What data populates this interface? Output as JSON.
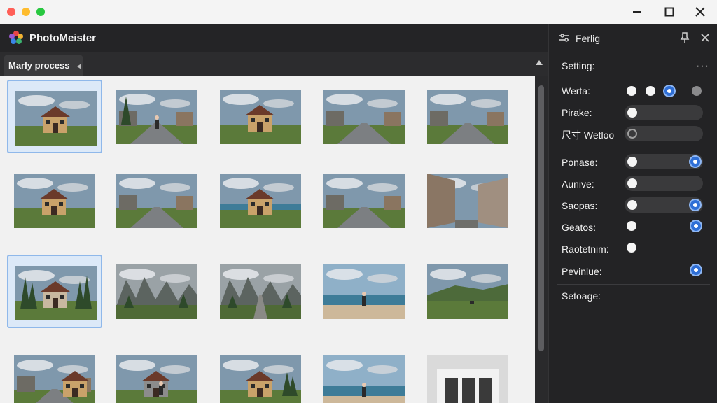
{
  "app": {
    "title": "PhotoMeister"
  },
  "tabs": [
    {
      "label": "Marly process"
    }
  ],
  "panel": {
    "title": "Ferlig",
    "settings_label": "Setting:",
    "rows": [
      {
        "label": "Werta:",
        "control": "radio-group",
        "selected_index": 2
      },
      {
        "label": "Pirake:",
        "control": "toggle",
        "value": "off"
      },
      {
        "label": "尺寸 Wetloo",
        "control": "toggle",
        "value": "off"
      },
      {
        "label": "Ponase:",
        "control": "toggle",
        "value": "on"
      },
      {
        "label": "Aunive:",
        "control": "toggle",
        "value": "off"
      },
      {
        "label": "Saopas:",
        "control": "toggle",
        "value": "on"
      },
      {
        "label": "Geatos:",
        "control": "toggle",
        "value": "on"
      },
      {
        "label": "Raotetnim:",
        "control": "toggle",
        "value": "off"
      },
      {
        "label": "Pevinlue:",
        "control": "toggle",
        "value": "on"
      },
      {
        "label": "Setoage:",
        "control": "none"
      }
    ]
  },
  "gallery": {
    "photos": [
      {
        "subject": "house",
        "selected": true
      },
      {
        "subject": "path-tree",
        "selected": false
      },
      {
        "subject": "house",
        "selected": false
      },
      {
        "subject": "road-village",
        "selected": false
      },
      {
        "subject": "road-village",
        "selected": false
      },
      {
        "subject": "house",
        "selected": false
      },
      {
        "subject": "road-village",
        "selected": false
      },
      {
        "subject": "house-coast",
        "selected": false
      },
      {
        "subject": "road-village",
        "selected": false
      },
      {
        "subject": "old-street",
        "selected": false
      },
      {
        "subject": "chapel-trees",
        "selected": true
      },
      {
        "subject": "mountains",
        "selected": false
      },
      {
        "subject": "mountains-path",
        "selected": false
      },
      {
        "subject": "beach-person",
        "selected": false
      },
      {
        "subject": "meadow-person",
        "selected": false
      },
      {
        "subject": "village",
        "selected": false
      },
      {
        "subject": "barn-person",
        "selected": false
      },
      {
        "subject": "house-trees",
        "selected": false
      },
      {
        "subject": "beach-person",
        "selected": false
      },
      {
        "subject": "building",
        "selected": false
      }
    ]
  },
  "colors": {
    "accent": "#2f6fd6",
    "panel_bg": "#232325",
    "gallery_bg": "#f1f1f1",
    "selection": "#8fb8ea"
  }
}
